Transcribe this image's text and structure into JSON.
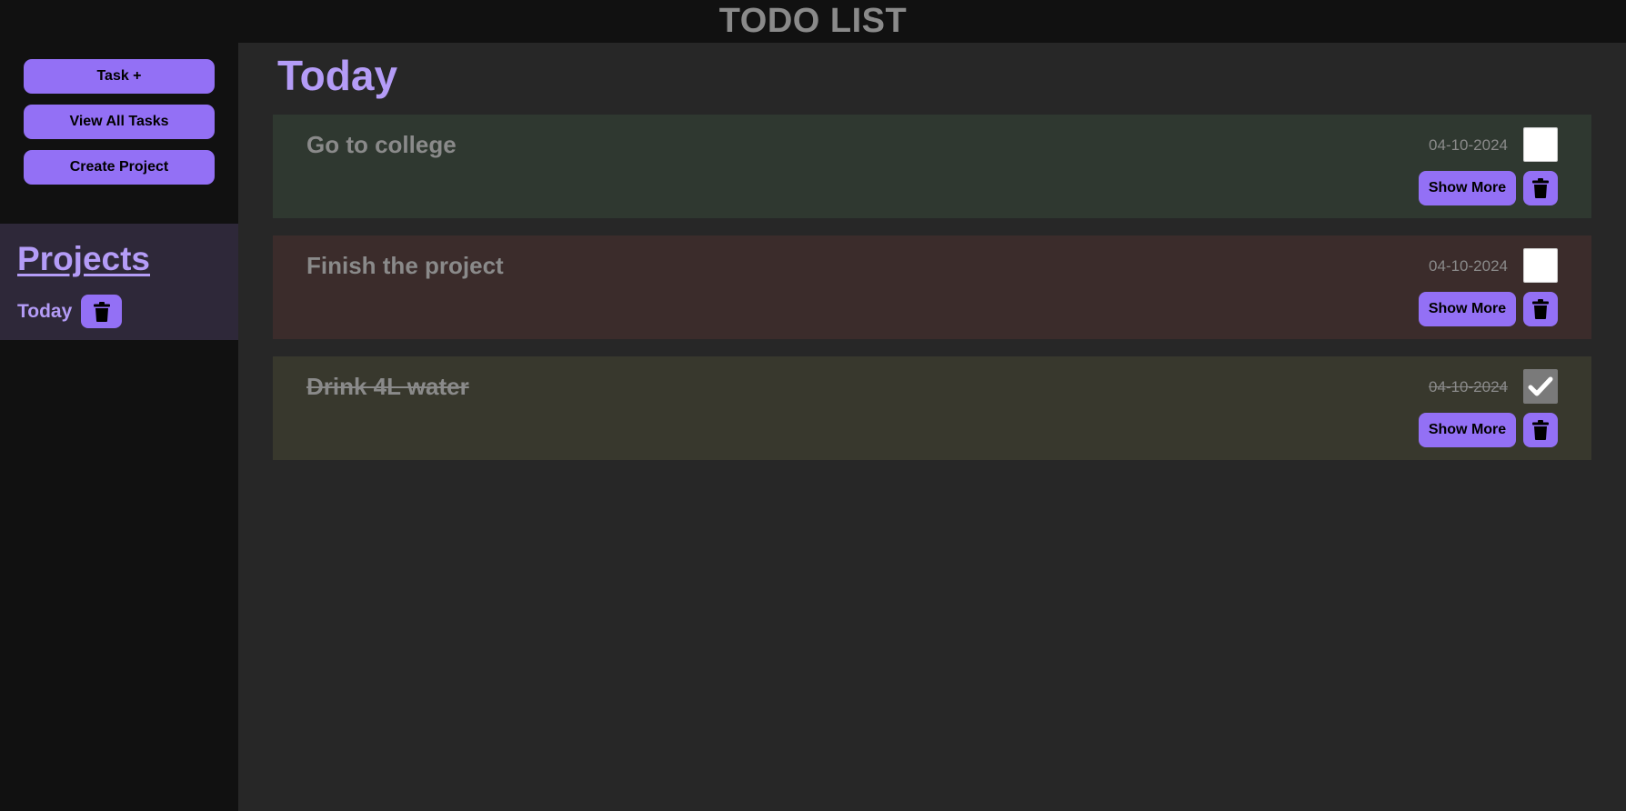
{
  "app": {
    "title": "TODO LIST"
  },
  "sidebar": {
    "buttons": [
      {
        "label": "Task +"
      },
      {
        "label": "View All Tasks"
      },
      {
        "label": "Create Project"
      }
    ],
    "projects": {
      "title": "Projects",
      "items": [
        {
          "label": "Today",
          "icon": "trash-icon"
        }
      ]
    }
  },
  "main": {
    "title": "Today",
    "tasks": [
      {
        "title": "Go to college",
        "date": "04-10-2024",
        "done": false,
        "bg": "#2f3830",
        "show_more": "Show More"
      },
      {
        "title": "Finish the project",
        "date": "04-10-2024",
        "done": false,
        "bg": "#3b2c2b",
        "show_more": "Show More"
      },
      {
        "title": "Drink 4L water",
        "date": "04-10-2024",
        "done": true,
        "bg": "#38382d",
        "show_more": "Show More"
      }
    ]
  },
  "colors": {
    "accent": "#9370f5",
    "accent_text": "#b49cf7",
    "muted_text": "#8a8a8a",
    "sidebar_bg": "#111111",
    "main_bg": "#272727",
    "projects_panel_bg": "#2e2839"
  }
}
